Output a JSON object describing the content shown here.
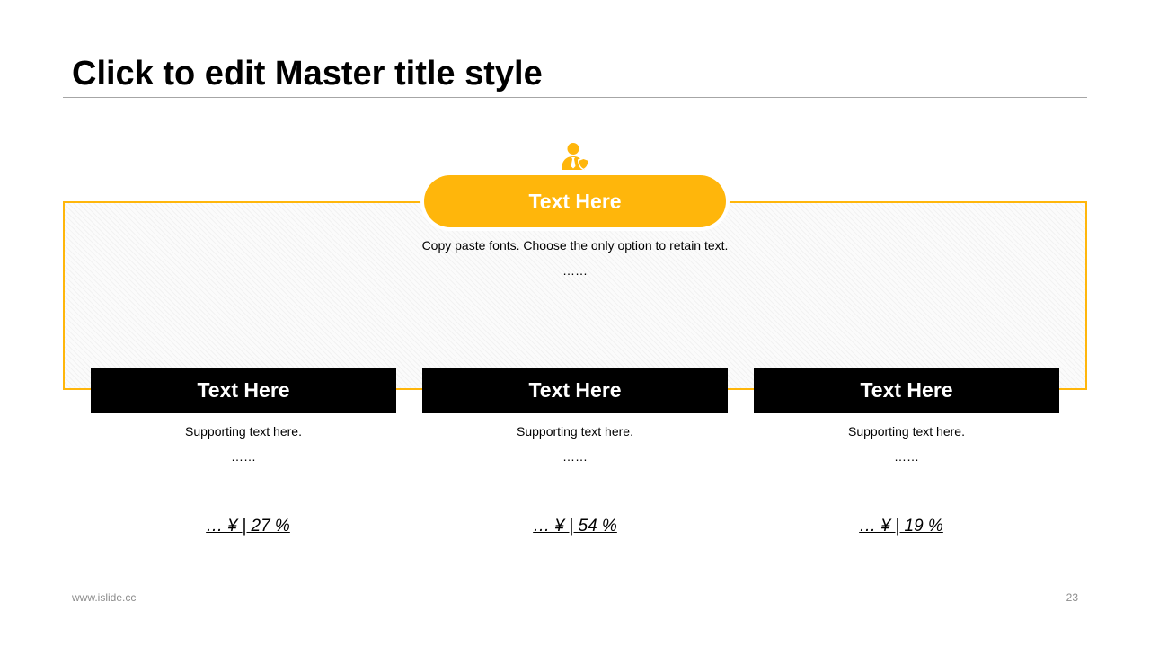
{
  "slide": {
    "title": "Click to edit Master title style",
    "accent_color": "#FFB60B"
  },
  "main": {
    "heading": "Text Here",
    "line1": "Copy paste fonts. Choose the only option to retain text.",
    "line2": "……",
    "icon": "person-shield-icon"
  },
  "columns": [
    {
      "heading": "Text Here",
      "line1": "Supporting text here.",
      "line2": "……",
      "stat": "…  ¥ | 27 %"
    },
    {
      "heading": "Text Here",
      "line1": "Supporting text here.",
      "line2": "……",
      "stat": "…  ¥ | 54 %"
    },
    {
      "heading": "Text Here",
      "line1": "Supporting text here.",
      "line2": "……",
      "stat": "…  ¥ | 19 %"
    }
  ],
  "footer": {
    "website": "www.islide.cc",
    "page_number": "23"
  }
}
